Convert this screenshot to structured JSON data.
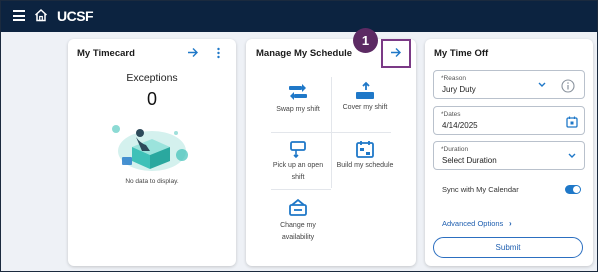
{
  "header": {
    "logo_text": "UCSF",
    "icons": [
      "menu-icon",
      "home-icon"
    ]
  },
  "timecard": {
    "title": "My Timecard",
    "exceptions_label": "Exceptions",
    "exceptions_value": "0",
    "empty_text": "No data to display.",
    "icons": [
      "arrow-right-icon",
      "more-vertical-icon",
      "empty-state-illustration"
    ]
  },
  "schedule": {
    "title": "Manage My Schedule",
    "step_badge": "1",
    "tiles": [
      {
        "icon": "swap-shift-icon",
        "label": "Swap my shift"
      },
      {
        "icon": "cover-shift-icon",
        "label": "Cover my shift"
      },
      {
        "icon": "pickup-shift-icon",
        "label": "Pick up an open shift"
      },
      {
        "icon": "build-schedule-icon",
        "label": "Build my schedule"
      },
      {
        "icon": "availability-icon",
        "label": "Change my availability"
      }
    ]
  },
  "timeoff": {
    "title": "My Time Off",
    "reason": {
      "label": "Reason",
      "value": "Jury Duty"
    },
    "dates": {
      "label": "Dates",
      "value": "4/14/2025"
    },
    "duration": {
      "label": "Duration",
      "value": "Select Duration"
    },
    "sync_label": "Sync with My Calendar",
    "sync_on": true,
    "advanced_label": "Advanced Options",
    "submit_label": "Submit"
  },
  "colors": {
    "nav_bg": "#0c2340",
    "accent": "#1f78c8",
    "badge": "#5c2a63",
    "illustration": "#3fc1b8"
  }
}
